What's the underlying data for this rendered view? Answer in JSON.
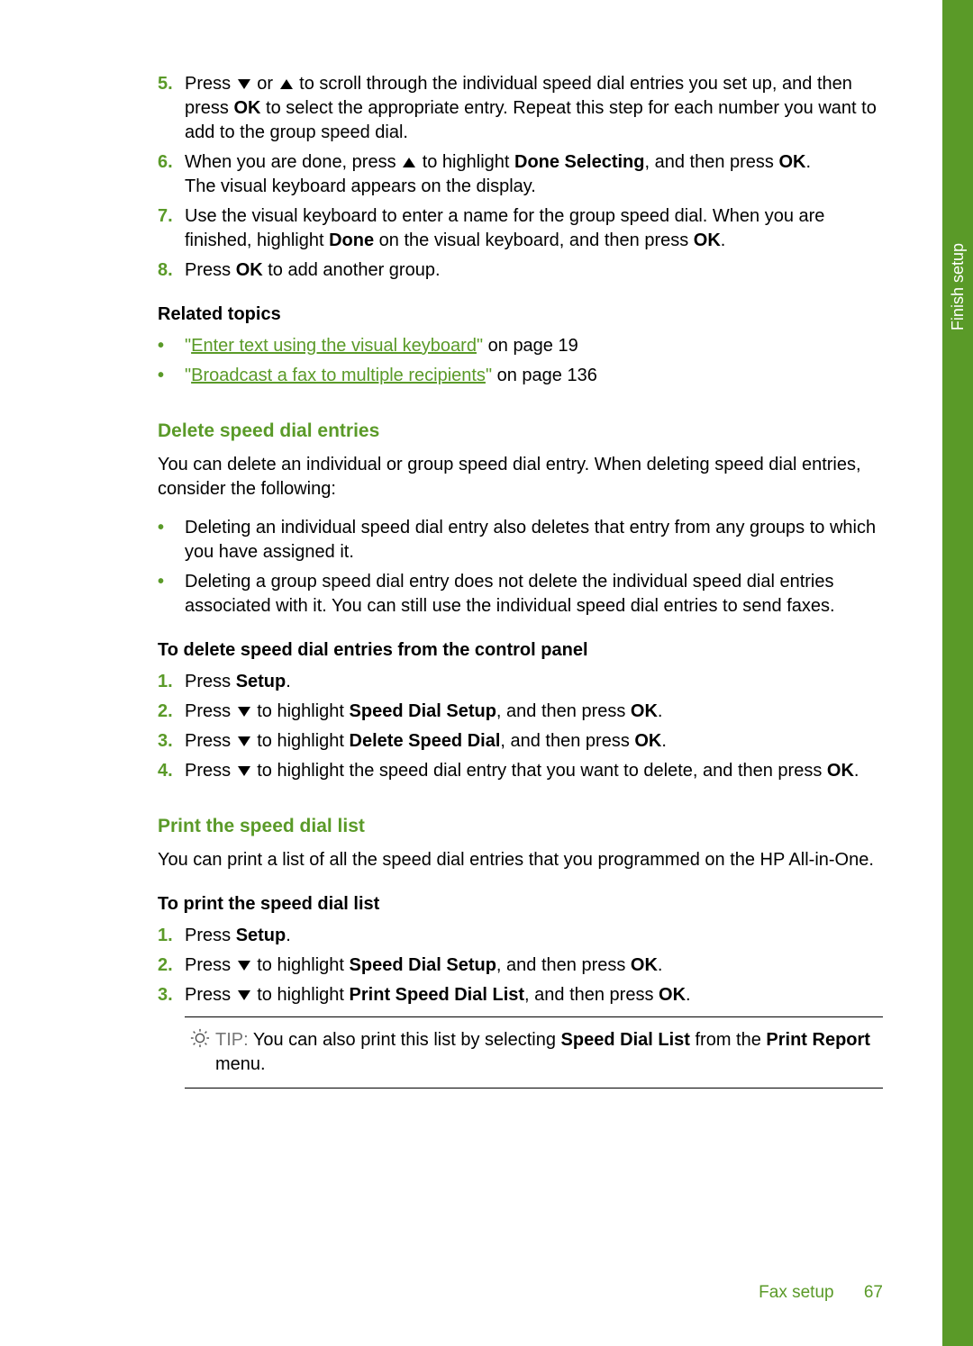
{
  "sidebar": {
    "label": "Finish setup"
  },
  "steps_top": [
    {
      "num": "5.",
      "parts": [
        "Press ",
        "DOWN",
        " or ",
        "UP",
        " to scroll through the individual speed dial entries you set up, and then press ",
        "BOLD:OK",
        " to select the appropriate entry. Repeat this step for each number you want to add to the group speed dial."
      ]
    },
    {
      "num": "6.",
      "parts": [
        "When you are done, press ",
        "UP",
        " to highlight ",
        "BOLD:Done Selecting",
        ", and then press ",
        "BOLD:OK",
        ". ",
        "BR",
        "The visual keyboard appears on the display."
      ]
    },
    {
      "num": "7.",
      "parts": [
        "Use the visual keyboard to enter a name for the group speed dial. When you are finished, highlight ",
        "BOLD:Done",
        " on the visual keyboard, and then press ",
        "BOLD:OK",
        "."
      ]
    },
    {
      "num": "8.",
      "parts": [
        "Press ",
        "BOLD:OK",
        " to add another group."
      ]
    }
  ],
  "related": {
    "heading": "Related topics",
    "items": [
      {
        "link": "Enter text using the visual keyboard",
        "tail": " on page 19"
      },
      {
        "link": "Broadcast a fax to multiple recipients",
        "tail": " on page 136"
      }
    ]
  },
  "delete": {
    "heading": "Delete speed dial entries",
    "para": "You can delete an individual or group speed dial entry. When deleting speed dial entries, consider the following:",
    "bullets": [
      "Deleting an individual speed dial entry also deletes that entry from any groups to which you have assigned it.",
      "Deleting a group speed dial entry does not delete the individual speed dial entries associated with it. You can still use the individual speed dial entries to send faxes."
    ],
    "procedure_heading": "To delete speed dial entries from the control panel",
    "steps": [
      {
        "num": "1.",
        "parts": [
          "Press ",
          "BOLD:Setup",
          "."
        ]
      },
      {
        "num": "2.",
        "parts": [
          "Press ",
          "DOWN",
          " to highlight ",
          "BOLD:Speed Dial Setup",
          ", and then press ",
          "BOLD:OK",
          "."
        ]
      },
      {
        "num": "3.",
        "parts": [
          "Press ",
          "DOWN",
          " to highlight ",
          "BOLD:Delete Speed Dial",
          ", and then press ",
          "BOLD:OK",
          "."
        ]
      },
      {
        "num": "4.",
        "parts": [
          "Press ",
          "DOWN",
          " to highlight the speed dial entry that you want to delete, and then press ",
          "BOLD:OK",
          "."
        ]
      }
    ]
  },
  "print": {
    "heading": "Print the speed dial list",
    "para": "You can print a list of all the speed dial entries that you programmed on the HP All-in-One.",
    "procedure_heading": "To print the speed dial list",
    "steps": [
      {
        "num": "1.",
        "parts": [
          "Press ",
          "BOLD:Setup",
          "."
        ]
      },
      {
        "num": "2.",
        "parts": [
          "Press ",
          "DOWN",
          " to highlight ",
          "BOLD:Speed Dial Setup",
          ", and then press ",
          "BOLD:OK",
          "."
        ]
      },
      {
        "num": "3.",
        "parts": [
          "Press ",
          "DOWN",
          " to highlight ",
          "BOLD:Print Speed Dial List",
          ", and then press ",
          "BOLD:OK",
          "."
        ]
      }
    ],
    "tip": {
      "label": "TIP:",
      "parts": [
        " You can also print this list by selecting ",
        "BOLD:Speed Dial List",
        " from the ",
        "BOLD:Print Report",
        " menu."
      ]
    }
  },
  "footer": {
    "section": "Fax setup",
    "page": "67"
  }
}
